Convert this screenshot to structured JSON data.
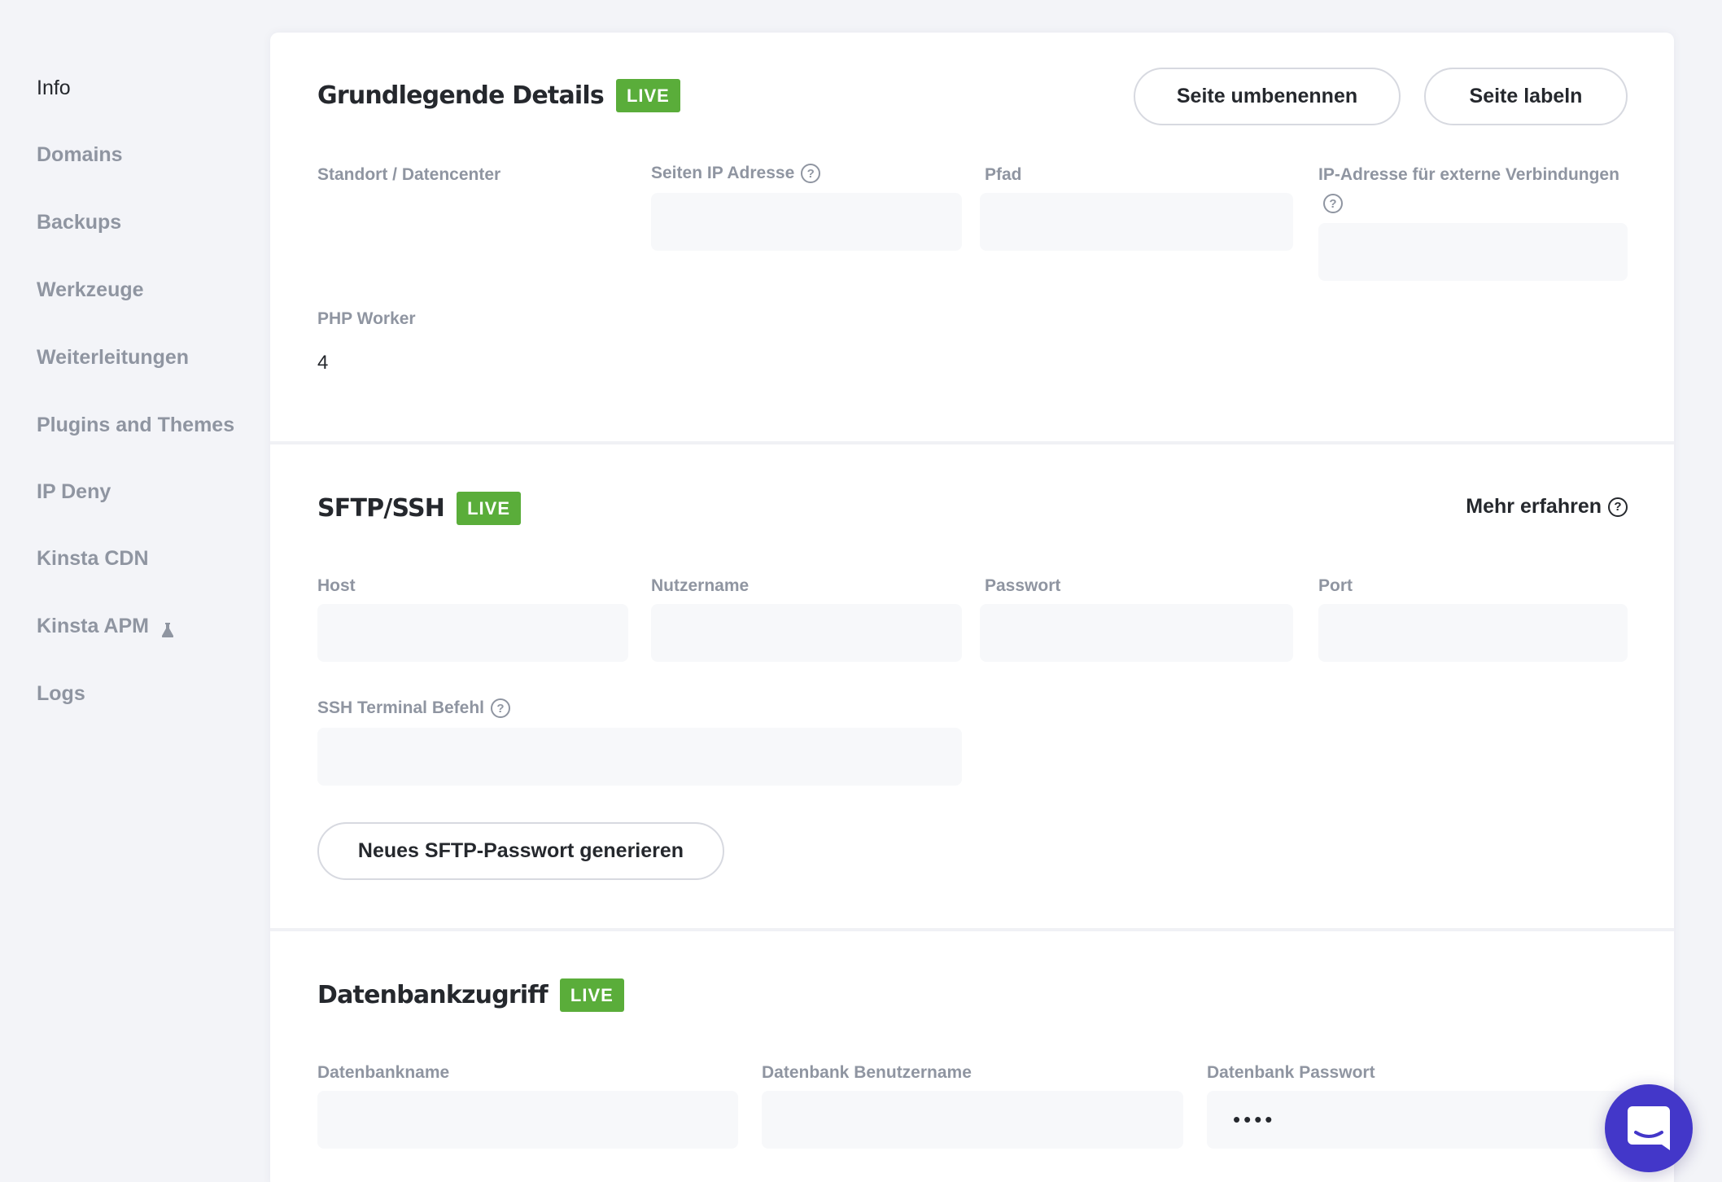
{
  "sidebar": {
    "items": [
      {
        "label": "Info",
        "active": true
      },
      {
        "label": "Domains"
      },
      {
        "label": "Backups"
      },
      {
        "label": "Werkzeuge"
      },
      {
        "label": "Weiterleitungen"
      },
      {
        "label": "Plugins and Themes"
      },
      {
        "label": "IP Deny"
      },
      {
        "label": "Kinsta CDN"
      },
      {
        "label": "Kinsta APM",
        "icon": "flask-icon"
      },
      {
        "label": "Logs"
      }
    ]
  },
  "basic": {
    "title": "Grundlegende Details",
    "badge": "LIVE",
    "rename_button": "Seite umbenennen",
    "label_button": "Seite labeln",
    "fields": {
      "location_label": "Standort / Datencenter",
      "location_value": "",
      "ip_label": "Seiten IP Adresse",
      "ip_value": "",
      "path_label": "Pfad",
      "path_value": "",
      "external_ip_label": "IP-Adresse für externe Verbindungen",
      "external_ip_value": "",
      "php_worker_label": "PHP Worker",
      "php_worker_value": "4"
    }
  },
  "sftp": {
    "title": "SFTP/SSH",
    "badge": "LIVE",
    "learn_more": "Mehr erfahren",
    "fields": {
      "host_label": "Host",
      "host_value": "",
      "user_label": "Nutzername",
      "user_value": "",
      "password_label": "Passwort",
      "password_value": "",
      "port_label": "Port",
      "port_value": "",
      "ssh_label": "SSH Terminal Befehl",
      "ssh_value": ""
    },
    "generate_button": "Neues SFTP-Passwort generieren"
  },
  "database": {
    "title": "Datenbankzugriff",
    "badge": "LIVE",
    "fields": {
      "name_label": "Datenbankname",
      "name_value": "",
      "user_label": "Datenbank Benutzername",
      "user_value": "",
      "password_label": "Datenbank Passwort",
      "password_value": "••••"
    }
  },
  "help_glyph": "?",
  "colors": {
    "live_badge": "#5aad3a",
    "chat_button": "#4337c9",
    "background": "#f3f4f8"
  }
}
